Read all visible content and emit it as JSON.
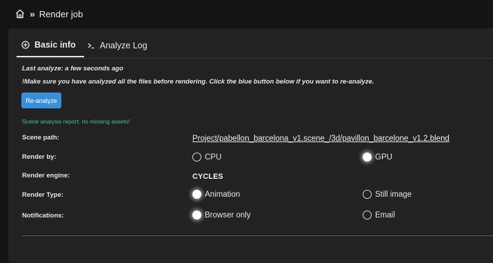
{
  "breadcrumb": {
    "home_icon": "home-icon",
    "separator": "»",
    "title": "Render job"
  },
  "tabs": [
    {
      "label": "Basic info",
      "icon": "plus-circle-icon",
      "active": true
    },
    {
      "label": "Analyze Log",
      "icon": "terminal-icon",
      "active": false
    }
  ],
  "info": {
    "last_analyze": "Last analyze: a few seconds ago",
    "warning": "!Make sure you have analyzed all the files before rendering. Click the blue button below if you want to re-analyze.",
    "reanalyze_button": "Re-analyze",
    "report": "Scene analysis report: no missing assets!"
  },
  "fields": {
    "scene_path": {
      "label": "Scene path:",
      "value": "Project/pabellon_barcelona_v1.scene_/3d/pavillon_barcelone_v1.2.blend"
    },
    "render_by": {
      "label": "Render by:",
      "options": [
        "CPU",
        "GPU"
      ],
      "selected": "GPU"
    },
    "render_engine": {
      "label": "Render engine:",
      "value": "CYCLES"
    },
    "render_type": {
      "label": "Render Type:",
      "options": [
        "Animation",
        "Still image"
      ],
      "selected": "Animation"
    },
    "notifications": {
      "label": "Notifications:",
      "options": [
        "Browser only",
        "Email"
      ],
      "selected": "Browser only"
    }
  },
  "colors": {
    "accent_button": "#3a8fd9",
    "success_text": "#4cc08f",
    "panel_bg": "#222222",
    "page_bg": "#141414"
  }
}
